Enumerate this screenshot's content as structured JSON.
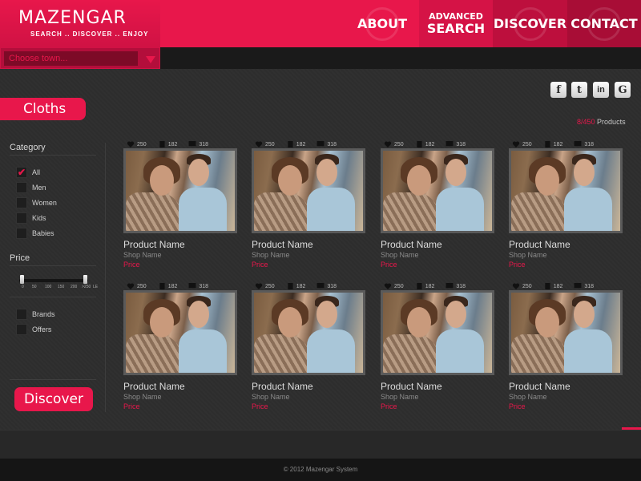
{
  "brand": {
    "title": "MAZENGAR",
    "tagline": "SEARCH .. DISCOVER .. ENJOY"
  },
  "nav": {
    "about": "ABOUT",
    "advanced_line1": "ADVANCED",
    "advanced_line2": "SEARCH",
    "discover": "DISCOVER",
    "contact": "CONTACT"
  },
  "town_select": {
    "placeholder": "Choose town..."
  },
  "social": [
    "f",
    "t",
    "in",
    "G"
  ],
  "section": {
    "title": "Cloths"
  },
  "products_count": {
    "shown": "8",
    "total": "/450",
    "label": " Products"
  },
  "sidebar": {
    "category_heading": "Category",
    "categories": [
      {
        "label": "All",
        "checked": true
      },
      {
        "label": "Men",
        "checked": false
      },
      {
        "label": "Women",
        "checked": false
      },
      {
        "label": "Kids",
        "checked": false
      },
      {
        "label": "Babies",
        "checked": false
      }
    ],
    "price_heading": "Price",
    "price_ticks": [
      "0",
      "50",
      "100",
      "150",
      "200",
      ">250",
      "LE"
    ],
    "extra_filters": [
      {
        "label": "Brands",
        "checked": false
      },
      {
        "label": "Offers",
        "checked": false
      }
    ],
    "discover_button": "Discover"
  },
  "products": [
    {
      "likes": "250",
      "fb": "182",
      "comments": "318",
      "name": "Product Name",
      "shop": "Shop Name",
      "price": "Price"
    },
    {
      "likes": "250",
      "fb": "182",
      "comments": "318",
      "name": "Product Name",
      "shop": "Shop Name",
      "price": "Price"
    },
    {
      "likes": "250",
      "fb": "182",
      "comments": "318",
      "name": "Product Name",
      "shop": "Shop Name",
      "price": "Price"
    },
    {
      "likes": "250",
      "fb": "182",
      "comments": "318",
      "name": "Product Name",
      "shop": "Shop Name",
      "price": "Price"
    },
    {
      "likes": "250",
      "fb": "182",
      "comments": "318",
      "name": "Product Name",
      "shop": "Shop Name",
      "price": "Price"
    },
    {
      "likes": "250",
      "fb": "182",
      "comments": "318",
      "name": "Product Name",
      "shop": "Shop Name",
      "price": "Price"
    },
    {
      "likes": "250",
      "fb": "182",
      "comments": "318",
      "name": "Product Name",
      "shop": "Shop Name",
      "price": "Price"
    },
    {
      "likes": "250",
      "fb": "182",
      "comments": "318",
      "name": "Product Name",
      "shop": "Shop Name",
      "price": "Price"
    }
  ],
  "footer": {
    "copyright": "© 2012 Mazengar System"
  },
  "colors": {
    "accent": "#e8174b",
    "background": "#2b2b2b"
  }
}
